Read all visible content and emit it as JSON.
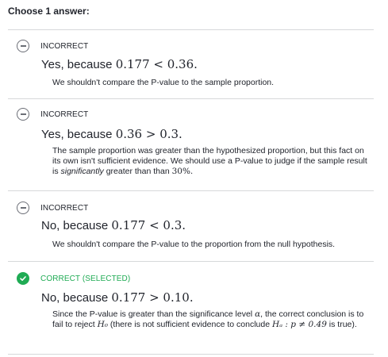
{
  "prompt": "Choose 1 answer:",
  "choices": [
    {
      "status": "INCORRECT",
      "title_text": "Yes, because ",
      "title_math": "0.177 < 0.36.",
      "rationale": "We shouldn't compare the P-value to the sample proportion."
    },
    {
      "status": "INCORRECT",
      "title_text": "Yes, because ",
      "title_math": "0.36 > 0.3.",
      "rationale_a": "The sample proportion was greater than the hypothesized proportion, but this fact on its own isn't sufficient evidence. We should use a P-value to judge if the sample result is ",
      "rationale_em": "significantly",
      "rationale_b": " greater than than ",
      "rationale_math": "30%.",
      "rationale_end": ""
    },
    {
      "status": "INCORRECT",
      "title_text": "No, because ",
      "title_math": "0.177 < 0.3.",
      "rationale": "We shouldn't compare the P-value to the proportion from the null hypothesis."
    },
    {
      "status": "CORRECT (SELECTED)",
      "title_text": "No, because ",
      "title_math": "0.177 > 0.10.",
      "rationale_a": "Since the P-value is greater than the significance level ",
      "rationale_alpha": "α",
      "rationale_b": ", the correct conclusion is to fail to reject ",
      "rationale_h0": "H₀",
      "rationale_c": " (there is not sufficient evidence to conclude ",
      "rationale_ha": "Hₐ : p ≠ 0.49",
      "rationale_d": " is true)."
    }
  ],
  "colors": {
    "text": "#21242c",
    "correct": "#1fab54",
    "divider": "#d6d8da",
    "icon_gray": "#6b6e76"
  },
  "icons": [
    "minus-circle-icon",
    "check-circle-icon"
  ]
}
